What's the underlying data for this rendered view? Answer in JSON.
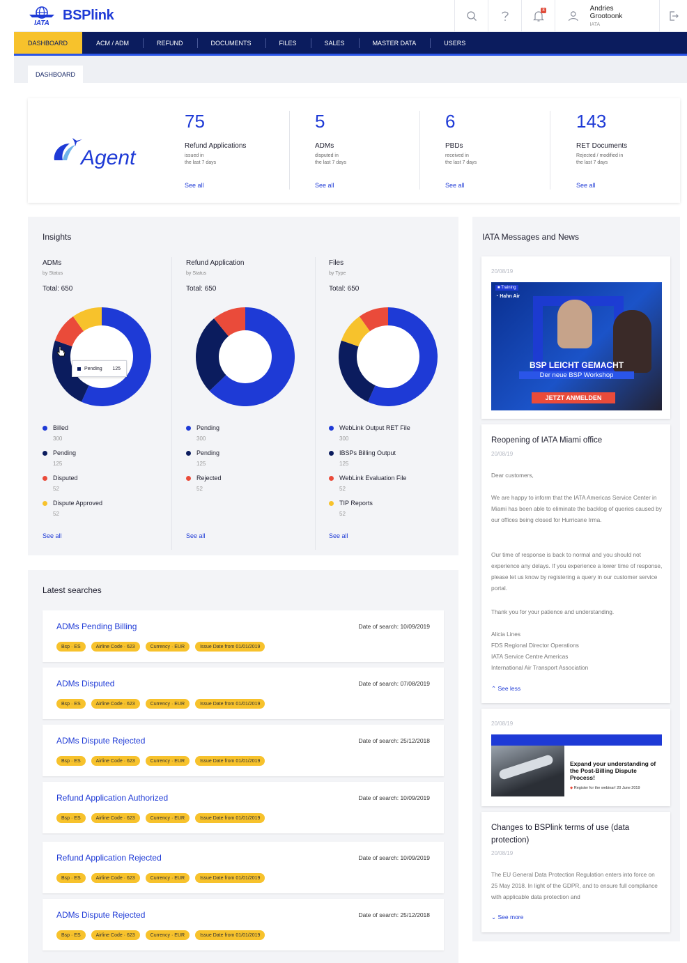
{
  "header": {
    "logo_org": "IATA",
    "brand": "BSPlink",
    "notif_count": "8",
    "user_name": "Andries Grootoonk",
    "user_org": "IATA"
  },
  "nav": [
    "DASHBOARD",
    "ACM / ADM",
    "REFUND",
    "DOCUMENTS",
    "FILES",
    "SALES",
    "MASTER DATA",
    "USERS"
  ],
  "breadcrumb": "DASHBOARD",
  "stats": {
    "logo_text": "Agent",
    "items": [
      {
        "value": "75",
        "label": "Refund Applications",
        "sub1": "issued in",
        "sub2": "the last 7 days",
        "link": "See all"
      },
      {
        "value": "5",
        "label": "ADMs",
        "sub1": "disputed in",
        "sub2": "the last 7 days",
        "link": "See all"
      },
      {
        "value": "6",
        "label": "PBDs",
        "sub1": "received in",
        "sub2": "the last 7 days",
        "link": "See all"
      },
      {
        "value": "143",
        "label": "RET Documents",
        "sub1": "Rejected / modified in",
        "sub2": "the last 7 days",
        "link": "See all"
      }
    ]
  },
  "insights": {
    "title": "Insights",
    "tooltip": {
      "label": "Pending",
      "value": "125"
    },
    "columns": [
      {
        "title": "ADMs",
        "subtitle": "by Status",
        "total": "Total: 650",
        "link": "See all",
        "legend": [
          {
            "name": "Billed",
            "value": "300",
            "color": "#1e3ad6"
          },
          {
            "name": "Pending",
            "value": "125",
            "color": "#0b1c5e"
          },
          {
            "name": "Disputed",
            "value": "52",
            "color": "#ea4b3a"
          },
          {
            "name": "Dispute Approved",
            "value": "52",
            "color": "#f7c22c"
          }
        ]
      },
      {
        "title": "Refund Application",
        "subtitle": "by Status",
        "total": "Total: 650",
        "link": "See all",
        "legend": [
          {
            "name": "Pending",
            "value": "300",
            "color": "#1e3ad6"
          },
          {
            "name": "Pending",
            "value": "125",
            "color": "#0b1c5e"
          },
          {
            "name": "Rejected",
            "value": "52",
            "color": "#ea4b3a"
          }
        ]
      },
      {
        "title": "Files",
        "subtitle": "by Type",
        "total": "Total: 650",
        "link": "See all",
        "legend": [
          {
            "name": "WebLink Output RET File",
            "value": "300",
            "color": "#1e3ad6"
          },
          {
            "name": "IBSPs Billing Output",
            "value": "125",
            "color": "#0b1c5e"
          },
          {
            "name": "WebLink Evaluation File",
            "value": "52",
            "color": "#ea4b3a"
          },
          {
            "name": "TIP Reports",
            "value": "52",
            "color": "#f7c22c"
          }
        ]
      }
    ]
  },
  "searches": {
    "title": "Latest searches",
    "tags": [
      "Bsp · ES",
      "Airline Code · 623",
      "Currency · EUR",
      "Issue Date from 01/01/2019"
    ],
    "items": [
      {
        "title": "ADMs Pending Billing",
        "date": "Date of search: 10/09/2019"
      },
      {
        "title": "ADMs Disputed",
        "date": "Date of search: 07/08/2019"
      },
      {
        "title": "ADMs Dispute Rejected",
        "date": "Date of search: 25/12/2018"
      },
      {
        "title": "Refund Application Authorized",
        "date": "Date of search: 10/09/2019"
      },
      {
        "title": "Refund Application Rejected",
        "date": "Date of search: 10/09/2019"
      },
      {
        "title": "ADMs Dispute Rejected",
        "date": "Date of search: 25/12/2018"
      }
    ]
  },
  "news": {
    "title": "IATA Messages and News",
    "card1": {
      "date": "20/08/19",
      "badge": "Training",
      "airline": "Hahn Air",
      "headline": "BSP LEICHT GEMACHT",
      "subline": "Der neue BSP Workshop",
      "cta": "JETZT ANMELDEN"
    },
    "card2": {
      "title": "Reopening of IATA Miami office",
      "date": "20/08/19",
      "p1": "Dear customers,",
      "p2": "We are happy to inform that the IATA Americas Service Center in Miami has been able to eliminate the backlog of queries caused by our offices being closed for Hurricane Irma.",
      "p3": "Our time of response is back to normal and you should not experience any delays. If you experience a lower time of response, please let us know by registering a query in our customer service portal.",
      "p4": "Thank you for your patience and understanding.",
      "sig1": "Alicia Lines",
      "sig2": "FDS Regional Director Operations",
      "sig3": "IATA Service Centre Americas",
      "sig4": "International Air Transport Association",
      "link": "See less"
    },
    "card3": {
      "date": "20/08/19",
      "headline": "Expand your understanding of the Post-Billing Dispute Process!",
      "register": "Register for the webinar! 20 June 2019"
    },
    "card4": {
      "title": "Changes to BSPlink terms of use (data protection)",
      "date": "20/08/19",
      "text": "The EU General Data Protection Regulation enters into force on 25 May 2018. In light of the GDPR, and to ensure full compliance with applicable data protection and",
      "link": "See more"
    }
  }
}
